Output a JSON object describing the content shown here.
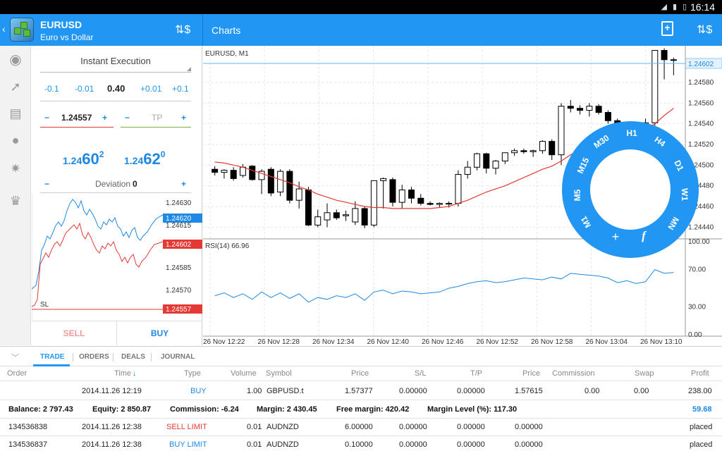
{
  "status_bar": {
    "time": "16:14"
  },
  "header": {
    "symbol": "EURUSD",
    "symbol_desc": "Euro vs  Dollar",
    "chart_title": "Charts"
  },
  "trade_panel": {
    "execution": "Instant Execution",
    "volume_steps": [
      "-0.1",
      "-0.01",
      "0.40",
      "+0.01",
      "+0.1"
    ],
    "sl_minus": "−",
    "sl_value": "1.24557",
    "sl_plus": "+",
    "tp_minus": "−",
    "tp_placeholder": "TP",
    "tp_plus": "+",
    "sell_price": {
      "prefix": "1.24",
      "big": "60",
      "sup": "2"
    },
    "buy_price": {
      "prefix": "1.24",
      "big": "62",
      "sup": "0"
    },
    "deviation_minus": "−",
    "deviation_label": "Deviation",
    "deviation_value": "0",
    "deviation_plus": "+",
    "mini_chart": {
      "ticks": [
        "1.24630",
        "1.24615",
        "1.24585",
        "1.24570"
      ],
      "ask_label": "1.24620",
      "bid_label": "1.24602",
      "sl_label": "1.24557",
      "sl_text": "SL"
    },
    "sell_label": "SELL",
    "buy_label": "BUY"
  },
  "chart": {
    "title": "EURUSD, M1",
    "rsi_title": "RSI(14) 66.96",
    "price_ticks": [
      "1.24580",
      "1.24560",
      "1.24540",
      "1.24520",
      "1.24500",
      "1.24480",
      "1.24460",
      "1.24440"
    ],
    "current_price": "1.24602",
    "rsi_ticks": [
      "100.00",
      "70.00",
      "30.00",
      "0.00"
    ],
    "time_ticks": [
      "26 Nov 12:22",
      "26 Nov 12:28",
      "26 Nov 12:34",
      "26 Nov 12:40",
      "26 Nov 12:46",
      "26 Nov 12:52",
      "26 Nov 12:58",
      "26 Nov 13:04",
      "26 Nov 13:10"
    ]
  },
  "timeframes": [
    "H1",
    "H4",
    "D1",
    "W1",
    "MN",
    "M1",
    "M5",
    "M15",
    "M30"
  ],
  "wheel_buttons": {
    "crosshair": "+",
    "indicator": "f"
  },
  "chart_data": {
    "type": "candlestick",
    "x": [
      "12:20",
      "12:21",
      "12:22",
      "12:23",
      "12:24",
      "12:25",
      "12:26",
      "12:27",
      "12:28",
      "12:29",
      "12:30",
      "12:31",
      "12:32",
      "12:33",
      "12:34",
      "12:35",
      "12:36",
      "12:37",
      "12:38",
      "12:39",
      "12:40",
      "12:41",
      "12:42",
      "12:43",
      "12:44",
      "12:45",
      "12:46",
      "12:47",
      "12:48",
      "12:49",
      "12:50",
      "12:51",
      "12:52",
      "12:53",
      "12:54",
      "12:55",
      "12:56",
      "12:57",
      "12:58",
      "12:59",
      "13:00",
      "13:01",
      "13:02",
      "13:03",
      "13:04",
      "13:05",
      "13:06",
      "13:07",
      "13:08",
      "13:09",
      "13:10",
      "13:11"
    ],
    "ohlc": [
      [
        1.24496,
        1.24499,
        1.2449,
        1.24493
      ],
      [
        1.24493,
        1.24496,
        1.24487,
        1.24495
      ],
      [
        1.24495,
        1.24498,
        1.24485,
        1.24487
      ],
      [
        1.2449,
        1.24501,
        1.24488,
        1.24498
      ],
      [
        1.24499,
        1.245,
        1.24485,
        1.24486
      ],
      [
        1.24486,
        1.24496,
        1.24472,
        1.24494
      ],
      [
        1.24496,
        1.24498,
        1.2447,
        1.24473
      ],
      [
        1.24474,
        1.24496,
        1.2447,
        1.24494
      ],
      [
        1.24494,
        1.24496,
        1.24463,
        1.24466
      ],
      [
        1.24466,
        1.24484,
        1.24458,
        1.24477
      ],
      [
        1.24476,
        1.24479,
        1.24441,
        1.24442
      ],
      [
        1.24442,
        1.24457,
        1.2444,
        1.2445
      ],
      [
        1.24447,
        1.24463,
        1.2444,
        1.24454
      ],
      [
        1.24454,
        1.24457,
        1.24447,
        1.24449
      ],
      [
        1.24451,
        1.24456,
        1.24446,
        1.24452
      ],
      [
        1.24445,
        1.24465,
        1.24442,
        1.24458
      ],
      [
        1.24458,
        1.2446,
        1.24439,
        1.24442
      ],
      [
        1.24442,
        1.24471,
        1.2444,
        1.24485
      ],
      [
        1.24485,
        1.24488,
        1.24458,
        1.24487
      ],
      [
        1.24486,
        1.24488,
        1.2446,
        1.24464
      ],
      [
        1.24464,
        1.24481,
        1.24458,
        1.24476
      ],
      [
        1.24476,
        1.24479,
        1.24463,
        1.24468
      ],
      [
        1.24468,
        1.24472,
        1.24461,
        1.24463
      ],
      [
        1.24463,
        1.24465,
        1.24461,
        1.24462
      ],
      [
        1.24462,
        1.24464,
        1.24459,
        1.24463
      ],
      [
        1.24463,
        1.24465,
        1.24459,
        1.24463
      ],
      [
        1.24463,
        1.24495,
        1.2446,
        1.24491
      ],
      [
        1.24491,
        1.24504,
        1.24487,
        1.24498
      ],
      [
        1.24498,
        1.24512,
        1.24495,
        1.24511
      ],
      [
        1.24511,
        1.24512,
        1.24492,
        1.24497
      ],
      [
        1.24497,
        1.24505,
        1.24491,
        1.24504
      ],
      [
        1.24504,
        1.24512,
        1.24501,
        1.24512
      ],
      [
        1.24512,
        1.24516,
        1.24509,
        1.24514
      ],
      [
        1.24514,
        1.24516,
        1.24511,
        1.24513
      ],
      [
        1.24513,
        1.24515,
        1.24508,
        1.24514
      ],
      [
        1.24514,
        1.24524,
        1.24511,
        1.24523
      ],
      [
        1.24523,
        1.24525,
        1.24505,
        1.2451
      ],
      [
        1.2451,
        1.2456,
        1.245,
        1.24557
      ],
      [
        1.24557,
        1.24563,
        1.24551,
        1.24555
      ],
      [
        1.24555,
        1.24558,
        1.24549,
        1.24553
      ],
      [
        1.24553,
        1.2456,
        1.24547,
        1.24557
      ],
      [
        1.24557,
        1.24559,
        1.24549,
        1.24551
      ],
      [
        1.24551,
        1.24553,
        1.2454,
        1.24543
      ],
      [
        1.24543,
        1.24545,
        1.2452,
        1.24524
      ],
      [
        1.24524,
        1.24542,
        1.2452,
        1.2454
      ],
      [
        1.2454,
        1.24542,
        1.24527,
        1.2453
      ],
      [
        1.2453,
        1.24545,
        1.24525,
        1.24541
      ],
      [
        1.24541,
        1.246,
        1.24538,
        1.24611
      ],
      [
        1.24611,
        1.24613,
        1.24583,
        1.24602
      ],
      [
        1.24602,
        1.24604,
        1.24587,
        1.24602
      ]
    ],
    "ma_values": [
      1.24503,
      1.24502,
      1.245,
      1.24498,
      1.24495,
      1.24492,
      1.24489,
      1.24486,
      1.24483,
      1.24479,
      1.24476,
      1.24472,
      1.24469,
      1.24466,
      1.24464,
      1.24462,
      1.2446,
      1.24459,
      1.24459,
      1.24458,
      1.24458,
      1.24458,
      1.24458,
      1.24458,
      1.24459,
      1.2446,
      1.24463,
      1.24466,
      1.2447,
      1.24474,
      1.24477,
      1.2448,
      1.24484,
      1.24488,
      1.24492,
      1.24496,
      1.24499,
      1.24504,
      1.2451,
      1.24515,
      1.24519,
      1.24522,
      1.24525,
      1.24527,
      1.2453,
      1.24532,
      1.24535,
      1.2454,
      1.24548,
      1.24555
    ],
    "rsi_values": [
      42,
      45,
      40,
      44,
      38,
      46,
      40,
      45,
      39,
      44,
      35,
      40,
      38,
      42,
      40,
      44,
      37,
      46,
      48,
      44,
      47,
      46,
      44,
      45,
      46,
      50,
      52,
      55,
      57,
      58,
      56,
      57,
      59,
      61,
      60,
      59,
      62,
      60,
      66,
      65,
      64,
      63,
      61,
      56,
      58,
      55,
      57,
      70,
      66,
      67
    ],
    "ylim": [
      1.2443,
      1.2461
    ],
    "rsi_ylim": [
      0,
      100
    ]
  },
  "toolbox": {
    "tabs": [
      "TRADE",
      "ORDERS",
      "DEALS",
      "JOURNAL"
    ],
    "columns": [
      "Order",
      "Time",
      "Type",
      "Volume",
      "Symbol",
      "Price",
      "S/L",
      "T/P",
      "Price",
      "Commission",
      "Swap",
      "Profit"
    ],
    "positions": [
      {
        "order": "",
        "time": "2014.11.26 12:19",
        "type": "BUY",
        "volume": "1.00",
        "symbol": "GBPUSD.t",
        "price": "1.57377",
        "sl": "0.00000",
        "tp": "0.00000",
        "cur_price": "1.57615",
        "commission": "0.00",
        "swap": "0.00",
        "profit": "238.00"
      }
    ],
    "summary": {
      "balance": "Balance:  2 797.43",
      "equity": "Equity:  2 850.87",
      "commission": "Commission:  -6.24",
      "margin": "Margin:  2 430.45",
      "free_margin": "Free margin:  420.42",
      "margin_level": "Margin Level (%):  117.30",
      "total": "59.68"
    },
    "orders": [
      {
        "order": "134536838",
        "time": "2014.11.26 12:38",
        "type": "SELL LIMIT",
        "volume": "0.01",
        "symbol": "AUDNZD",
        "price": "6.00000",
        "sl": "0.00000",
        "tp": "0.00000",
        "cur_price": "0.00000",
        "status": "placed"
      },
      {
        "order": "134536837",
        "time": "2014.11.26 12:38",
        "type": "BUY LIMIT",
        "volume": "0.01",
        "symbol": "AUDNZD",
        "price": "0.10000",
        "sl": "0.00000",
        "tp": "0.00000",
        "cur_price": "0.00000",
        "status": "placed"
      }
    ]
  },
  "colors": {
    "accent": "#2196f3",
    "sell": "#e53935",
    "buy": "#1e88e5",
    "ma": "#e53935",
    "rsi": "#1e88e5"
  }
}
